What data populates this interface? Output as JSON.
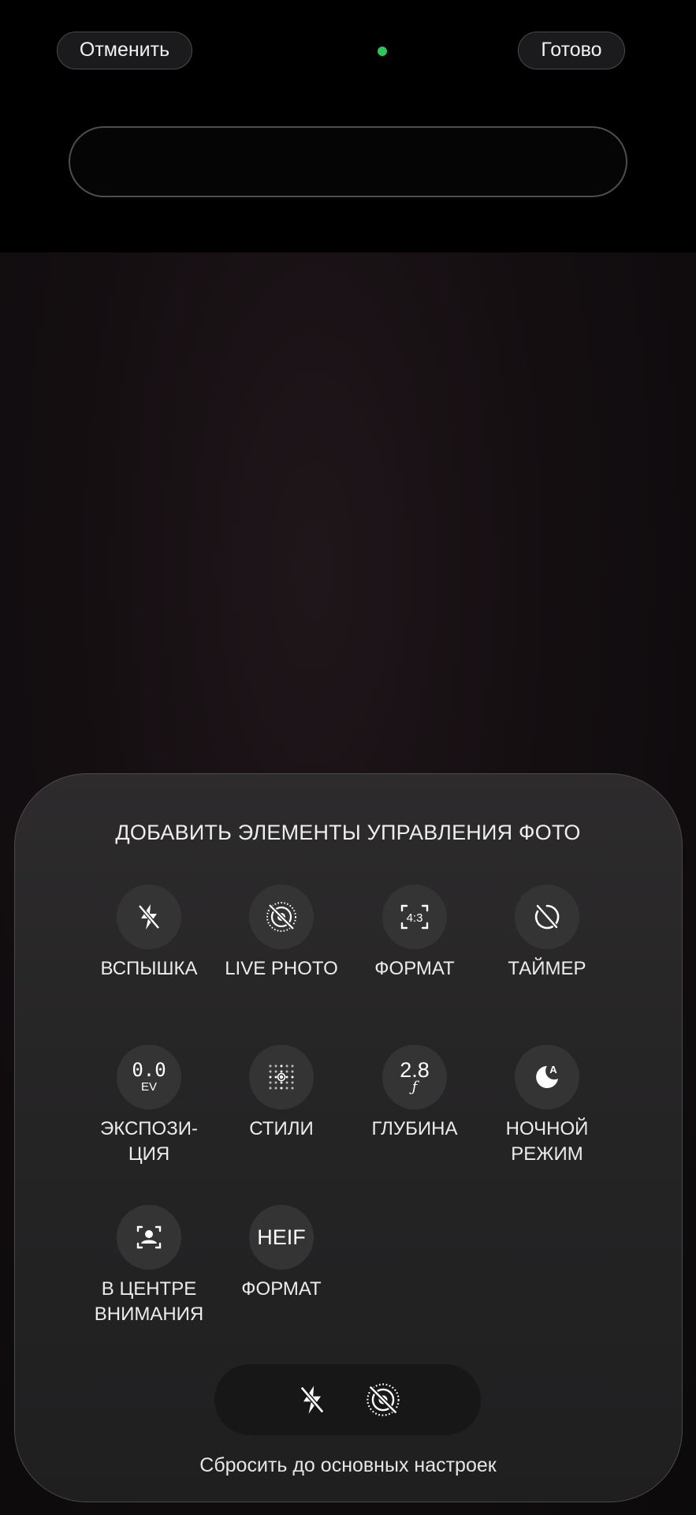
{
  "header": {
    "cancel_label": "Отменить",
    "done_label": "Готово",
    "indicator_color": "#2dc65a"
  },
  "sheet": {
    "title": "ДОБАВИТЬ ЭЛЕМЕНТЫ УПРАВЛЕНИЯ ФОТО",
    "controls": [
      {
        "label": "ВСПЫШКА",
        "icon": "flash-off-icon"
      },
      {
        "label": "LIVE PHOTO",
        "icon": "live-photo-off-icon"
      },
      {
        "label": "ФОРМАТ",
        "icon": "aspect-ratio-icon",
        "value": "4:3"
      },
      {
        "label": "ТАЙМЕР",
        "icon": "timer-off-icon"
      },
      {
        "label": "ЭКСПОЗИ-\nЦИЯ",
        "icon": "exposure-icon",
        "value": "0.0",
        "unit": "EV"
      },
      {
        "label": "СТИЛИ",
        "icon": "styles-icon"
      },
      {
        "label": "ГЛУБИНА",
        "icon": "depth-icon",
        "value": "2.8",
        "unit": "ƒ"
      },
      {
        "label": "НОЧНОЙ\nРЕЖИМ",
        "icon": "night-mode-icon",
        "badge": "A"
      },
      {
        "label": "В ЦЕНТРЕ\nВНИМАНИЯ",
        "icon": "center-stage-icon"
      },
      {
        "label": "ФОРМАТ",
        "icon": "heif-icon",
        "value": "HEIF"
      }
    ],
    "dock_items": [
      "flash-off-icon",
      "live-photo-off-icon"
    ],
    "reset_label": "Сбросить до основных настроек"
  }
}
